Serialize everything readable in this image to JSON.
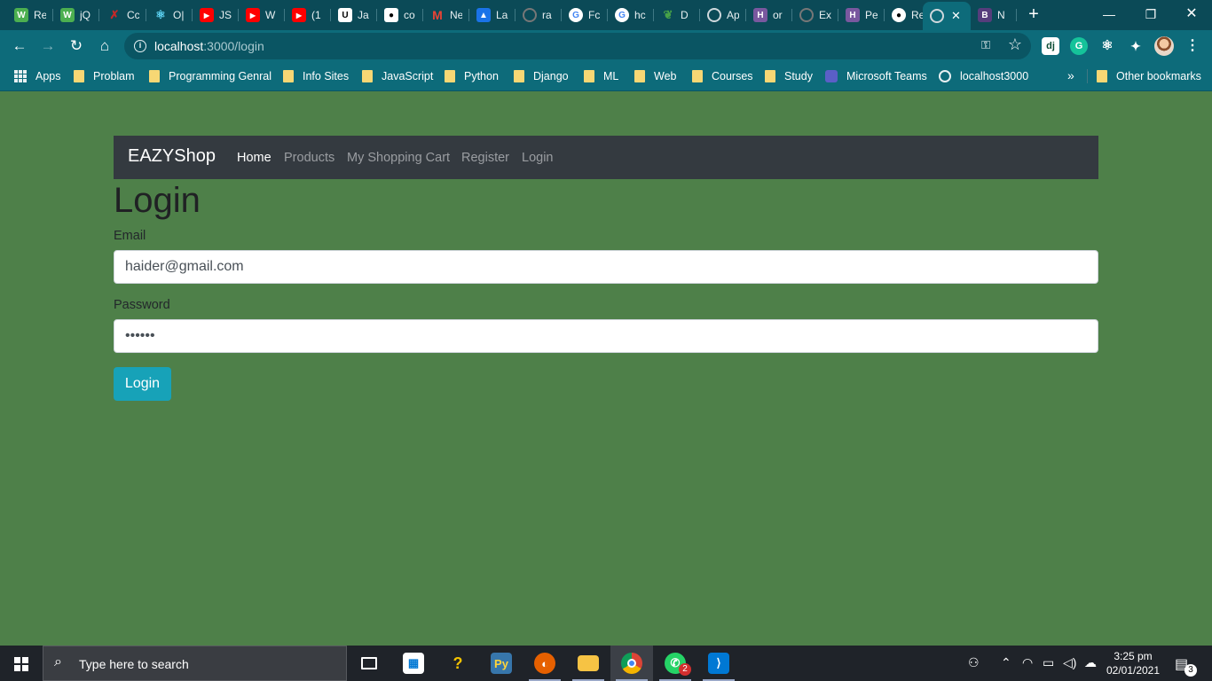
{
  "browser": {
    "tabs": [
      {
        "title": "Re",
        "icon": "wolfram-icon",
        "color": "#4caf50"
      },
      {
        "title": "jQ",
        "icon": "wolfram-icon",
        "color": "#4caf50"
      },
      {
        "title": "Cc",
        "icon": "coursera-icon",
        "color": "#c62828"
      },
      {
        "title": "O|",
        "icon": "react-icon",
        "color": "#61dafb"
      },
      {
        "title": "JS",
        "icon": "youtube-icon",
        "color": "#ff0000"
      },
      {
        "title": "W",
        "icon": "youtube-icon",
        "color": "#ff0000"
      },
      {
        "title": "(1",
        "icon": "youtube-icon",
        "color": "#ff0000"
      },
      {
        "title": "Ja",
        "icon": "udemy-icon",
        "color": "#000000"
      },
      {
        "title": "co",
        "icon": "github-dark-icon",
        "color": "#000000"
      },
      {
        "title": "Ne",
        "icon": "gmail-icon",
        "color": "#ea4335"
      },
      {
        "title": "La",
        "icon": "contacts-icon",
        "color": "#1a73e8"
      },
      {
        "title": "ra",
        "icon": "globe-icon",
        "color": "#777777"
      },
      {
        "title": "Fc",
        "icon": "google-icon",
        "color": "#ffffff"
      },
      {
        "title": "hc",
        "icon": "google-icon",
        "color": "#ffffff"
      },
      {
        "title": "D",
        "icon": "mongodb-icon",
        "color": "#47a248"
      },
      {
        "title": "Ap",
        "icon": "globe-icon",
        "color": "#cfd8dc"
      },
      {
        "title": "or",
        "icon": "heroku-icon",
        "color": "#79589f"
      },
      {
        "title": "Ex",
        "icon": "globe-icon",
        "color": "#777777"
      },
      {
        "title": "Pe",
        "icon": "heroku-icon",
        "color": "#79589f"
      },
      {
        "title": "Re",
        "icon": "github-icon",
        "color": "#ffffff"
      },
      {
        "title": "",
        "icon": "globe-icon",
        "color": "#cfd8dc",
        "active": true
      },
      {
        "title": "N",
        "icon": "bootstrap-icon",
        "color": "#563d7c"
      }
    ],
    "url_host": "localhost",
    "url_path": ":3000/login",
    "bookmarks": [
      {
        "label": "Apps",
        "icon": "apps-icon"
      },
      {
        "label": "Problam",
        "icon": "folder-icon"
      },
      {
        "label": "Programming Genral",
        "icon": "folder-icon"
      },
      {
        "label": "Info Sites",
        "icon": "folder-icon"
      },
      {
        "label": "JavaScript",
        "icon": "folder-icon"
      },
      {
        "label": "Python",
        "icon": "folder-icon"
      },
      {
        "label": "Django",
        "icon": "folder-icon"
      },
      {
        "label": "ML",
        "icon": "folder-icon"
      },
      {
        "label": "Web",
        "icon": "folder-icon"
      },
      {
        "label": "Courses",
        "icon": "folder-icon"
      },
      {
        "label": "Study",
        "icon": "folder-icon"
      },
      {
        "label": "Microsoft Teams",
        "icon": "teams-icon"
      },
      {
        "label": "localhost3000",
        "icon": "globe-icon"
      }
    ],
    "bookmarks_more": "»",
    "other_bookmarks": "Other bookmarks"
  },
  "app": {
    "brand": "EAZYShop",
    "nav": [
      "Home",
      "Products",
      "My Shopping Cart",
      "Register",
      "Login"
    ],
    "active_nav": "Home"
  },
  "login": {
    "title": "Login",
    "email_label": "Email",
    "email_value": "haider@gmail.com",
    "password_label": "Password",
    "password_value": "••••••",
    "submit_label": "Login"
  },
  "taskbar": {
    "search_placeholder": "Type here to search",
    "time": "3:25 pm",
    "date": "02/01/2021",
    "whatsapp_badge": "2",
    "notification_count": "3"
  }
}
